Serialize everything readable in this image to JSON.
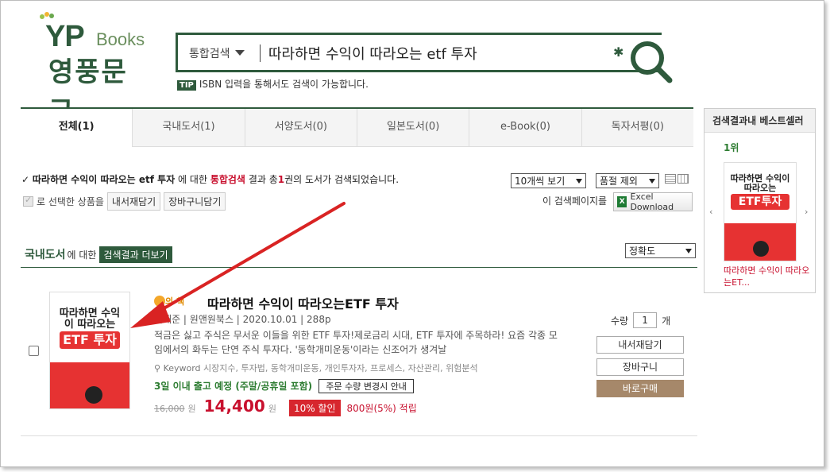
{
  "brand": {
    "yp": "YP",
    "books": "Books",
    "korean": "영풍문고",
    "accent": "#2e5a3c"
  },
  "search": {
    "category": "통합검색",
    "query": "따라하면 수익이 따라오는 etf 투자",
    "tip_badge": "TIP",
    "tip_text": "ISBN 입력을 통해서도 검색이 가능합니다."
  },
  "tabs": [
    {
      "label": "전체(1)",
      "active": true
    },
    {
      "label": "국내도서(1)",
      "active": false
    },
    {
      "label": "서양도서(0)",
      "active": false
    },
    {
      "label": "일본도서(0)",
      "active": false
    },
    {
      "label": "e-Book(0)",
      "active": false
    },
    {
      "label": "독자서평(0)",
      "active": false
    }
  ],
  "summary": {
    "query": "따라하면 수익이 따라오는 etf 투자",
    "mid": "에 대한",
    "type": "통합검색",
    "result_prefix": "결과 총",
    "count": "1",
    "result_suffix": "권의 도서가 검색되었습니다."
  },
  "controls": {
    "per_page": "10개씩 보기",
    "stock": "품절 제외",
    "selected_label": "로 선택한 상품을",
    "wishlist": "내서재담기",
    "cart": "장바구니담기",
    "export_label": "이 검색페이지를",
    "excel": "Excel Download"
  },
  "section": {
    "title": "국내도서",
    "for": "에 대한",
    "more": "검색결과 더보기",
    "sort": "정확도"
  },
  "book": {
    "badge": "의 책",
    "title": "따라하면 수익이 따라오는ETF 투자",
    "meta": "이재준 | 원앤원북스 | 2020.10.01 | 288p",
    "desc": "적금은 싫고 주식은 무서운 이들을 위한 ETF 투자!제로금리 시대, ETF 투자에 주목하라! 요즘 각종 모임에서의 화두는 단연 주식 투자다. '동학개미운동'이라는 신조어가 생겨날",
    "keyword_label": "Keyword",
    "keywords": "시장지수, 투자법, 동학개미운동, 개인투자자, 프로세스, 자산관리, 위험분석",
    "ship": "3일 이내 출고 예정",
    "ship_note": "(주말/공휴일 포함)",
    "ship_btn": "주문 수량 변경시 안내",
    "orig_price": "16,000",
    "won": "원",
    "price": "14,400",
    "discount": "10% 할인",
    "points": "800원(5%) 적립",
    "qty_label": "수량",
    "qty": "1",
    "qty_unit": "개",
    "btn_wish": "내서재담기",
    "btn_cart": "장바구니",
    "btn_buy": "바로구매",
    "cover_title": "따라하면 수익이 따라오는",
    "cover_etf": "ETF 투자"
  },
  "bestseller": {
    "title": "검색결과내 베스트셀러",
    "rank": "1위",
    "name": "따라하면 수익이 따라오는ET...",
    "cover_title": "따라하면 수익이 따라오는",
    "cover_etf": "ETF투자",
    "prev": "‹",
    "next": "›"
  }
}
